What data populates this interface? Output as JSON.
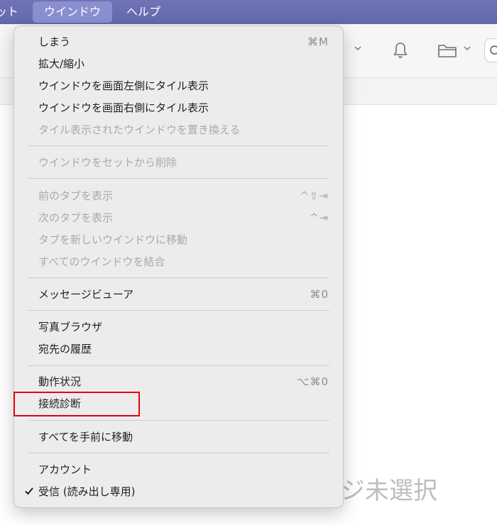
{
  "menubar": {
    "items": [
      {
        "label": "ット",
        "active": false
      },
      {
        "label": "ウインドウ",
        "active": true
      },
      {
        "label": "ヘルプ",
        "active": false
      }
    ]
  },
  "background": {
    "no_selection_text": "ジ未選択"
  },
  "window_menu": {
    "items": [
      {
        "label": "しまう",
        "shortcut": "⌘M",
        "enabled": true
      },
      {
        "label": "拡大/縮小",
        "shortcut": "",
        "enabled": true
      },
      {
        "label": "ウインドウを画面左側にタイル表示",
        "shortcut": "",
        "enabled": true
      },
      {
        "label": "ウインドウを画面右側にタイル表示",
        "shortcut": "",
        "enabled": true
      },
      {
        "label": "タイル表示されたウインドウを置き換える",
        "shortcut": "",
        "enabled": false
      },
      {
        "label": "ウインドウをセットから削除",
        "shortcut": "",
        "enabled": false
      },
      {
        "label": "前のタブを表示",
        "shortcut": "^⇧⇥",
        "enabled": false
      },
      {
        "label": "次のタブを表示",
        "shortcut": "^⇥",
        "enabled": false
      },
      {
        "label": "タブを新しいウインドウに移動",
        "shortcut": "",
        "enabled": false
      },
      {
        "label": "すべてのウインドウを結合",
        "shortcut": "",
        "enabled": false
      },
      {
        "label": "メッセージビューア",
        "shortcut": "⌘0",
        "enabled": true
      },
      {
        "label": "写真ブラウザ",
        "shortcut": "",
        "enabled": true
      },
      {
        "label": "宛先の履歴",
        "shortcut": "",
        "enabled": true
      },
      {
        "label": "動作状況",
        "shortcut": "⌥⌘0",
        "enabled": true
      },
      {
        "label": "接続診断",
        "shortcut": "",
        "enabled": true,
        "highlighted": true
      },
      {
        "label": "すべてを手前に移動",
        "shortcut": "",
        "enabled": true
      },
      {
        "label": "アカウント",
        "shortcut": "",
        "enabled": true
      },
      {
        "label": "受信 (読み出し専用)",
        "shortcut": "",
        "enabled": true,
        "checked": true
      }
    ]
  },
  "colors": {
    "menubar_bg": "#6368ad",
    "menubar_active": "#8a8fcf",
    "highlight_border": "#e60012"
  },
  "icons": [
    "bell-icon",
    "folder-icon",
    "search-icon",
    "chevron-down-icon",
    "checkmark-icon"
  ]
}
